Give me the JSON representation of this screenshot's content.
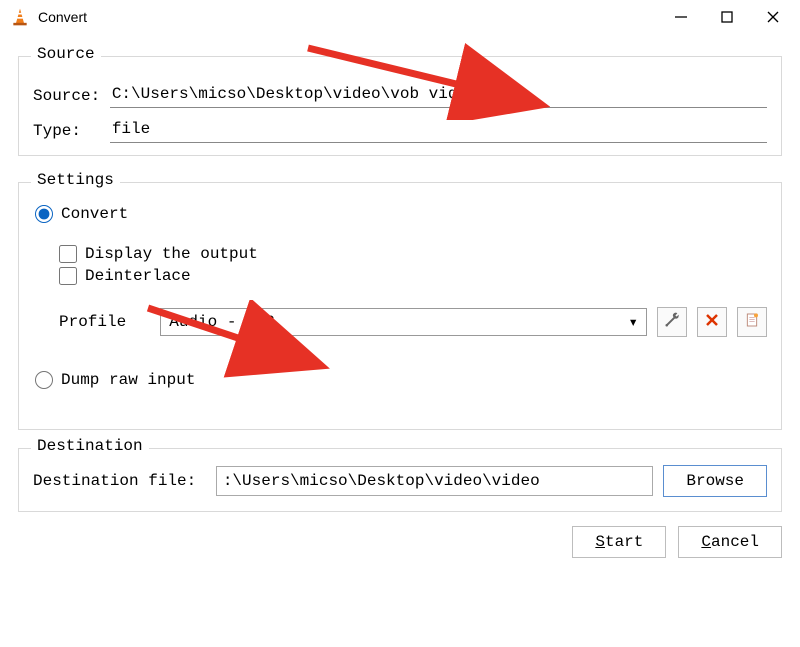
{
  "titlebar": {
    "title": "Convert"
  },
  "source": {
    "legend": "Source",
    "source_label": "Source: ",
    "source_value": "C:\\Users\\micso\\Desktop\\video\\vob video.vob",
    "type_label": "Type:   ",
    "type_value": "file"
  },
  "settings": {
    "legend": "Settings",
    "convert_label": "Convert",
    "display_output_label": "Display the output",
    "deinterlace_label": "Deinterlace",
    "profile_label": "Profile",
    "profile_value": "Audio - MP3",
    "dump_label": "Dump raw input"
  },
  "destination": {
    "legend": "Destination",
    "destfile_label": "Destination file: ",
    "destfile_value": ":\\Users\\micso\\Desktop\\video\\video",
    "browse": "Browse"
  },
  "footer": {
    "start": "Start",
    "cancel": "Cancel"
  }
}
